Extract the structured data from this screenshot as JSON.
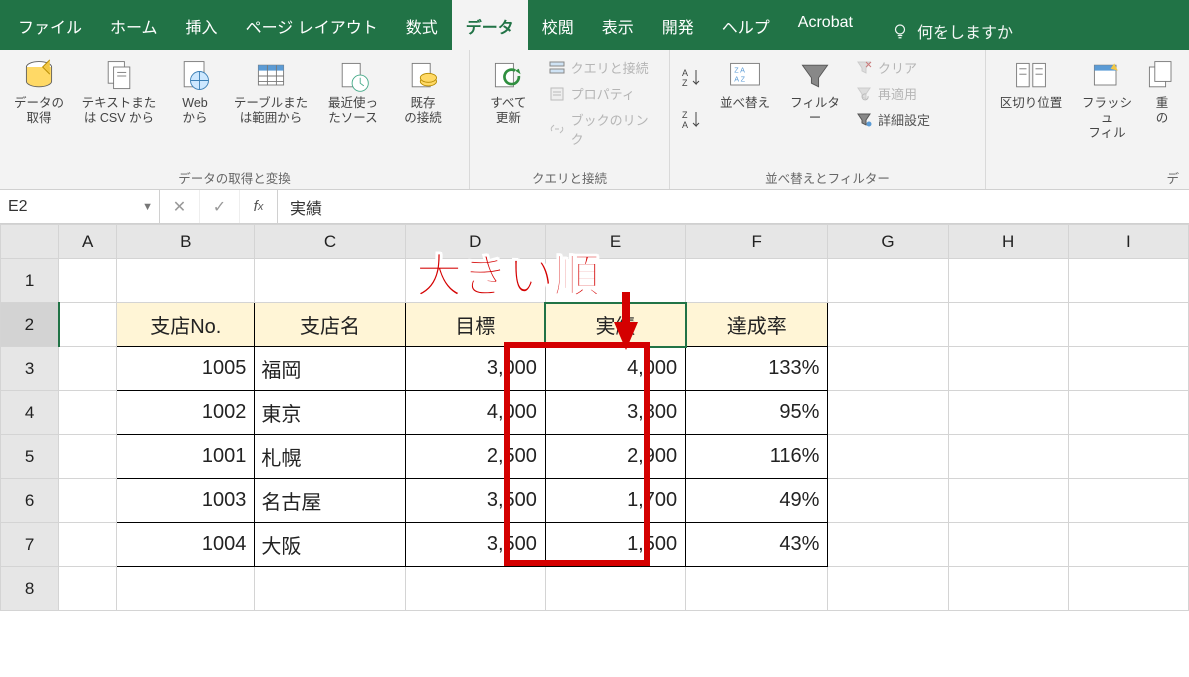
{
  "tabs": {
    "file": "ファイル",
    "home": "ホーム",
    "insert": "挿入",
    "pagelayout": "ページ レイアウト",
    "formulas": "数式",
    "data": "データ",
    "review": "校閲",
    "view": "表示",
    "developer": "開発",
    "help": "ヘルプ",
    "acrobat": "Acrobat",
    "tellme": "何をしますか"
  },
  "ribbon": {
    "group1_label": "データの取得と変換",
    "getdata": "データの\n取得",
    "fromcsv": "テキストまた\nは CSV から",
    "fromweb": "Web\nから",
    "fromtable": "テーブルまた\nは範囲から",
    "recent": "最近使っ\nたソース",
    "existing": "既存\nの接続",
    "group2_label": "クエリと接続",
    "refresh": "すべて\n更新",
    "queries": "クエリと接続",
    "properties": "プロパティ",
    "links": "ブックのリンク",
    "group3_label": "並べ替えとフィルター",
    "sort": "並べ替え",
    "filter": "フィルター",
    "clear": "クリア",
    "reapply": "再適用",
    "advanced": "詳細設定",
    "group4_label": "デ",
    "texttocol": "区切り位置",
    "flashfill": "フラッシュ\nフィル",
    "dup": "重\nの"
  },
  "fbar": {
    "namebox": "E2",
    "formula": "実績"
  },
  "cols": {
    "A": "A",
    "B": "B",
    "C": "C",
    "D": "D",
    "E": "E",
    "F": "F",
    "G": "G",
    "H": "H",
    "I": "I"
  },
  "rowlabels": [
    "1",
    "2",
    "3",
    "4",
    "5",
    "6",
    "7",
    "8"
  ],
  "headers": {
    "b": "支店No.",
    "c": "支店名",
    "d": "目標",
    "e": "実績",
    "f": "達成率"
  },
  "rows": [
    {
      "no": "1005",
      "name": "福岡",
      "target": "3,000",
      "actual": "4,000",
      "rate": "133%"
    },
    {
      "no": "1002",
      "name": "東京",
      "target": "4,000",
      "actual": "3,800",
      "rate": "95%"
    },
    {
      "no": "1001",
      "name": "札幌",
      "target": "2,500",
      "actual": "2,900",
      "rate": "116%"
    },
    {
      "no": "1003",
      "name": "名古屋",
      "target": "3,500",
      "actual": "1,700",
      "rate": "49%"
    },
    {
      "no": "1004",
      "name": "大阪",
      "target": "3,500",
      "actual": "1,500",
      "rate": "43%"
    }
  ],
  "annotation": "大きい順"
}
